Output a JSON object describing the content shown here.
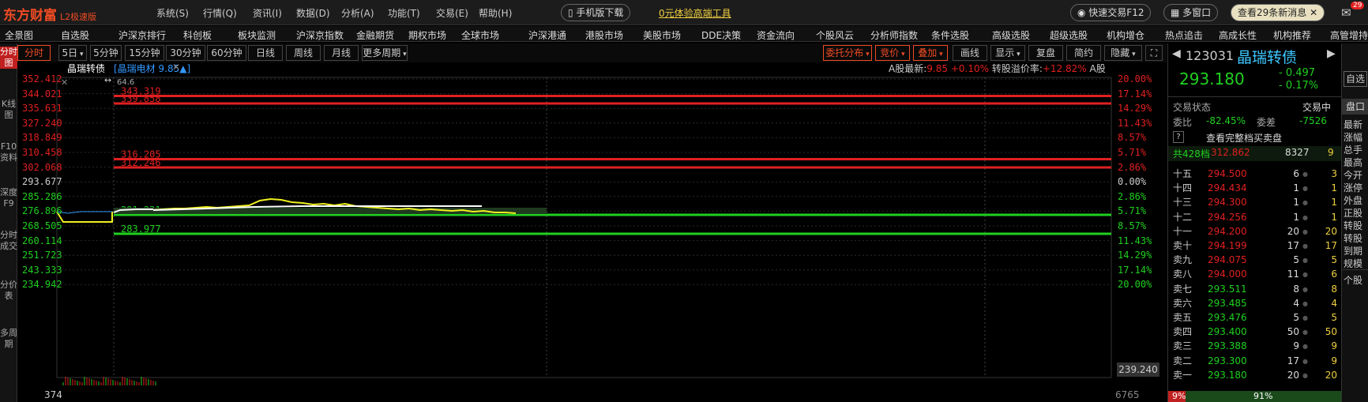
{
  "app": {
    "logo": "东方财富",
    "edition": "L2极速版"
  },
  "menu": [
    "系统(S)",
    "行情(Q)",
    "资讯(I)",
    "数据(D)",
    "分析(A)",
    "功能(T)",
    "交易(E)",
    "帮助(H)"
  ],
  "top_buttons": {
    "mobile": "手机版下载",
    "trial": "0元体验高端工具",
    "quick_trade": "快速交易F12",
    "multi_window": "多窗口",
    "news": "查看29条新消息",
    "mail_badge": "29"
  },
  "nav": [
    "全景图",
    "自选股",
    "沪深京排行",
    "科创板",
    "板块监测",
    "沪深京指数",
    "金融期货",
    "期权市场",
    "全球市场",
    "沪深港通",
    "港股市场",
    "美股市场",
    "DDE决策",
    "资金流向",
    "个股风云",
    "分析师指数",
    "条件选股",
    "高级选股",
    "超级选股",
    "机构增仓",
    "热点追击",
    "高成长性",
    "机构推荐",
    "高管增持"
  ],
  "toolbar": {
    "periods": [
      "分时",
      "5日",
      "5分钟",
      "15分钟",
      "30分钟",
      "60分钟",
      "日线",
      "周线",
      "月线",
      "更多周期"
    ],
    "right": [
      "委托分布",
      "竞价",
      "叠加",
      "画线",
      "显示",
      "复盘",
      "简约",
      "隐藏"
    ]
  },
  "sidebar": [
    "分时图",
    "K线图",
    "F10资料",
    "深度F9",
    "分时成交",
    "分价表",
    "多周期"
  ],
  "chart": {
    "name": "晶瑞转债",
    "overlay": "[晶瑞电材 9.85▲]",
    "a_latest_label": "A股最新:",
    "a_latest": "9.85",
    "a_change": "+0.10%",
    "premium_label": "转股溢价率:",
    "premium": "+12.82%",
    "a_tag": "A股",
    "small_label": "64.6",
    "y_left": [
      "352.412",
      "344.021",
      "335.631",
      "327.240",
      "318.849",
      "310.458",
      "302.068",
      "293.677",
      "285.286",
      "276.896",
      "268.505",
      "260.114",
      "251.723",
      "243.333",
      "234.942"
    ],
    "y_right": [
      "20.00%",
      "17.14%",
      "14.29%",
      "11.43%",
      "8.57%",
      "5.71%",
      "2.86%",
      "0.00%",
      "2.86%",
      "5.71%",
      "8.57%",
      "11.43%",
      "14.29%",
      "17.14%",
      "20.00%"
    ],
    "lines": [
      {
        "label": "343.319",
        "color": "#e02020"
      },
      {
        "label": "339.858",
        "color": "#e02020"
      },
      {
        "label": "316.205",
        "color": "#e02020"
      },
      {
        "label": "312.246",
        "color": "#e02020"
      },
      {
        "label": "291.231",
        "color": "#20d020"
      },
      {
        "label": "283.977",
        "color": "#20d020"
      }
    ],
    "vol_left": "374",
    "vol_right": "6765",
    "cursor_value": "239.240"
  },
  "quote": {
    "code": "123031",
    "name": "晶瑞转债",
    "price": "293.180",
    "change": "- 0.497",
    "change_pct": "- 0.17%",
    "status_label": "交易状态",
    "status": "交易中",
    "wb_label": "委比",
    "wb": "-82.45%",
    "wc_label": "委差",
    "wc": "-7526",
    "full_book": "查看完整档买卖盘",
    "total_label": "共428档",
    "total_price": "312.862",
    "total_vol": "8327",
    "total_n": "9",
    "bottom_left": "9%",
    "bottom_right": "91%",
    "rows": [
      {
        "label": "十五",
        "price": "294.500",
        "vol": "6",
        "n": "3"
      },
      {
        "label": "十四",
        "price": "294.434",
        "vol": "1",
        "n": "1"
      },
      {
        "label": "十三",
        "price": "294.300",
        "vol": "1",
        "n": "1"
      },
      {
        "label": "十二",
        "price": "294.256",
        "vol": "1",
        "n": "1"
      },
      {
        "label": "十一",
        "price": "294.200",
        "vol": "20",
        "n": "20"
      },
      {
        "label": "卖十",
        "price": "294.199",
        "vol": "17",
        "n": "17"
      },
      {
        "label": "卖九",
        "price": "294.075",
        "vol": "5",
        "n": "5"
      },
      {
        "label": "卖八",
        "price": "294.000",
        "vol": "11",
        "n": "6"
      },
      {
        "label": "卖七",
        "price": "293.511",
        "vol": "8",
        "n": "8"
      },
      {
        "label": "卖六",
        "price": "293.485",
        "vol": "4",
        "n": "4"
      },
      {
        "label": "卖五",
        "price": "293.476",
        "vol": "5",
        "n": "5"
      },
      {
        "label": "卖四",
        "price": "293.400",
        "vol": "50",
        "n": "50"
      },
      {
        "label": "卖三",
        "price": "293.388",
        "vol": "9",
        "n": "9"
      },
      {
        "label": "卖二",
        "price": "293.300",
        "vol": "17",
        "n": "9"
      },
      {
        "label": "卖一",
        "price": "293.180",
        "vol": "20",
        "n": "20"
      }
    ]
  },
  "far_right": {
    "self_select": "自选",
    "tab": "盘口",
    "items": [
      "最新",
      "涨幅",
      "总手",
      "最高",
      "今开",
      "涨停",
      "外盘",
      "正股",
      "转股",
      "转股",
      "到期",
      "规模"
    ],
    "bottom": "个股"
  },
  "colors": {
    "up": "#e02020",
    "down": "#20d020",
    "accent": "#f04b23",
    "price_line": "#f0f020",
    "avg_line": "#ffffff"
  }
}
